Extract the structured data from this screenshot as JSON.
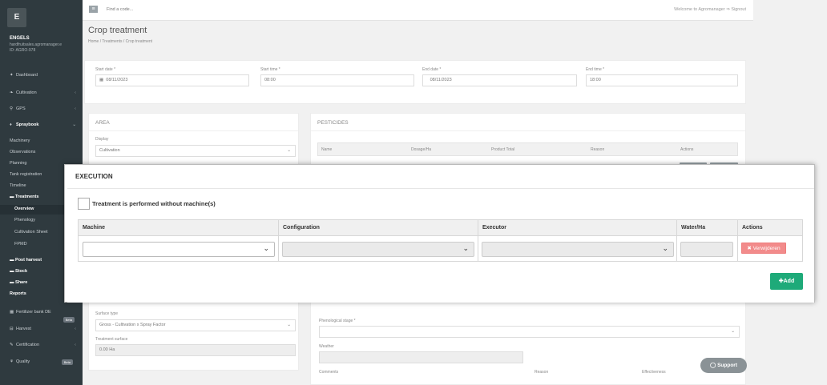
{
  "sidebar": {
    "avatar": "E",
    "user_name": "ENGELS",
    "user_email": "hardfruitsales.agromanager.e",
    "user_id": "ID: AGRO-978",
    "items": [
      {
        "icon": "dashboard-icon",
        "glyph": "✦",
        "label": "Dashboard"
      },
      {
        "icon": "leaf-icon",
        "glyph": "❧",
        "label": "Cultivation"
      },
      {
        "icon": "pin-icon",
        "glyph": "⚲",
        "label": "GPS"
      },
      {
        "icon": "bottle-icon",
        "glyph": "♦",
        "label": "Spraybook"
      }
    ],
    "spraybook_sub": [
      "Machinery",
      "Observations",
      "Planning",
      "Tank registration",
      "Timeline",
      "Treatments"
    ],
    "treatments_sub": [
      "Overview",
      "Phenology",
      "Cultivation Sheet",
      "FPMD"
    ],
    "folders": [
      "Post harvest",
      "Stock",
      "Share"
    ],
    "reports": "Reports",
    "bottom_items": [
      {
        "icon": "bank-icon",
        "glyph": "▦",
        "label": "Fertilizer bank DE",
        "badge": "Beta"
      },
      {
        "icon": "basket-icon",
        "glyph": "⊟",
        "label": "Harvest"
      },
      {
        "icon": "certificate-icon",
        "glyph": "✎",
        "label": "Certification"
      },
      {
        "icon": "quality-icon",
        "glyph": "⚘",
        "label": "Quality",
        "badge": "Beta"
      }
    ]
  },
  "topbar": {
    "search_placeholder": "Find a code...",
    "welcome": "Welcome to Agromanager",
    "signout": "⇒ Signout"
  },
  "page": {
    "title": "Crop treatment",
    "breadcrumb": "Home  /  Treatments  /  Crop treatment"
  },
  "dates": {
    "start_date_label": "Start date *",
    "start_date": "08/11/2023",
    "start_time_label": "Start time *",
    "start_time": "08:00",
    "end_date_label": "End date *",
    "end_date": "08/11/2023",
    "end_time_label": "End time *",
    "end_time": "18:00"
  },
  "area": {
    "title": "AREA",
    "display_label": "Display",
    "display_value": "Cultivation",
    "surface_type_label": "Surface type",
    "surface_type_value": "Gross - Cultivation x Spray Factor",
    "treatment_surface_label": "Treatment surface",
    "treatment_surface_value": "0.00 Ha"
  },
  "pesticides": {
    "title": "PESTICIDES",
    "columns": [
      "Name",
      "Dosage/Ha",
      "Product Total",
      "Reason",
      "Actions"
    ]
  },
  "lower": {
    "phenological_label": "Phenological stage *",
    "weather_label": "Weather",
    "comments_label": "Comments",
    "reason_label": "Reason",
    "effectiveness_label": "Effectiveness"
  },
  "execution": {
    "title": "EXECUTION",
    "checkbox_label": "Treatment is performed without machine(s)",
    "columns": [
      "Machine",
      "Configuration",
      "Executor",
      "Water/Ha",
      "Actions"
    ],
    "delete_label": "✖ Verwijderen",
    "add_label": "✚Add"
  },
  "support_label": "◯ Support"
}
